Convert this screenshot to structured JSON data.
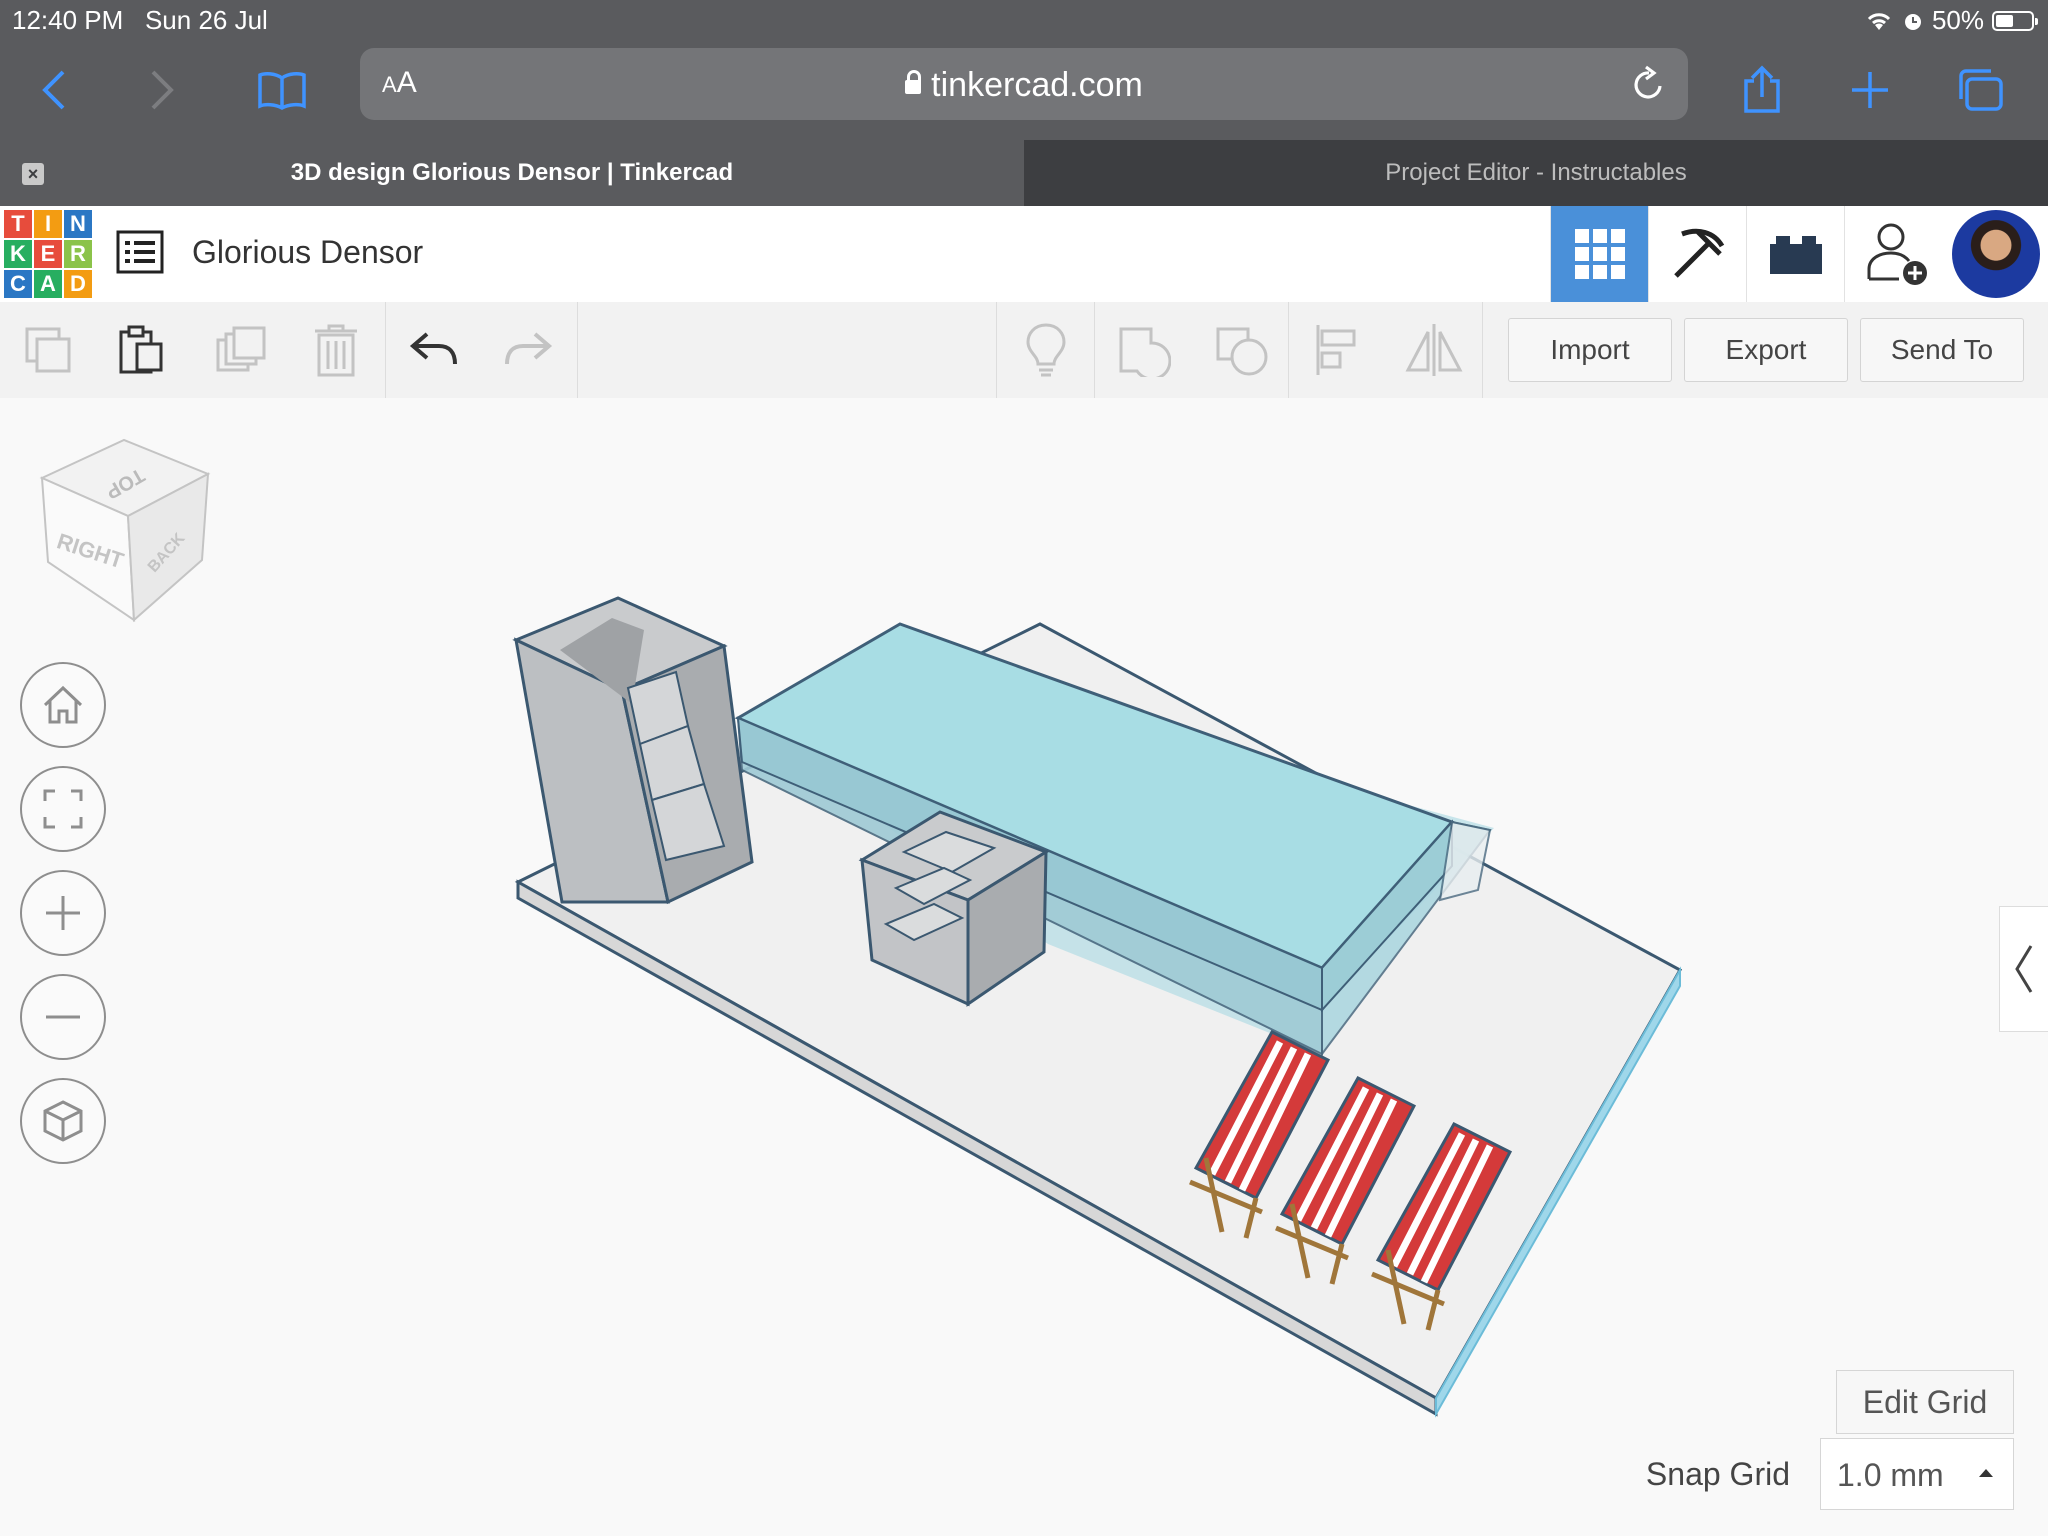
{
  "status_bar": {
    "time": "12:40 PM",
    "date": "Sun 26 Jul",
    "battery": "50%"
  },
  "browser": {
    "aa_small": "A",
    "aa_large": "A",
    "url": "tinkercad.com",
    "tabs": [
      {
        "label": "3D design Glorious Densor | Tinkercad",
        "active": true
      },
      {
        "label": "Project Editor - Instructables",
        "active": false
      }
    ]
  },
  "tinkercad": {
    "logo_letters": [
      "T",
      "I",
      "N",
      "K",
      "E",
      "R",
      "C",
      "A",
      "D"
    ],
    "logo_colors": [
      "#e74c3c",
      "#f39c12",
      "#2b77c4",
      "#27ae60",
      "#e74c3c",
      "#8bc34a",
      "#2b77c4",
      "#27ae60",
      "#f39c12"
    ],
    "design_title": "Glorious Densor",
    "toolbar": {
      "import": "Import",
      "export": "Export",
      "send_to": "Send To"
    },
    "viewcube": {
      "top": "TOP",
      "right": "RIGHT",
      "back": "BACK"
    },
    "edit_grid": "Edit Grid",
    "snap_grid_label": "Snap Grid",
    "snap_grid_value": "1.0 mm",
    "accent": "#4a90d9"
  }
}
